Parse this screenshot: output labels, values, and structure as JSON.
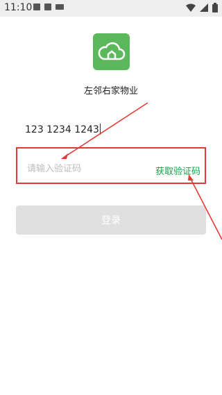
{
  "status_bar": {
    "time": "11:10",
    "left_icons": [
      "image-icon",
      "a-box-icon",
      "keyboard-icon"
    ],
    "right_icons": [
      "wifi-icon",
      "signal-icon",
      "battery-icon"
    ]
  },
  "app": {
    "name": "左邻右家物业",
    "logo_icon": "cloud-house-icon",
    "brand_color": "#5cb85c"
  },
  "form": {
    "phone_value": "123 1234 1243",
    "code_placeholder": "请输入验证码",
    "get_code_label": "获取验证码",
    "login_label": "登录"
  },
  "colors": {
    "accent_green": "#16a34a",
    "annotation_red": "#e53935",
    "disabled_button": "#e0e0e0"
  }
}
